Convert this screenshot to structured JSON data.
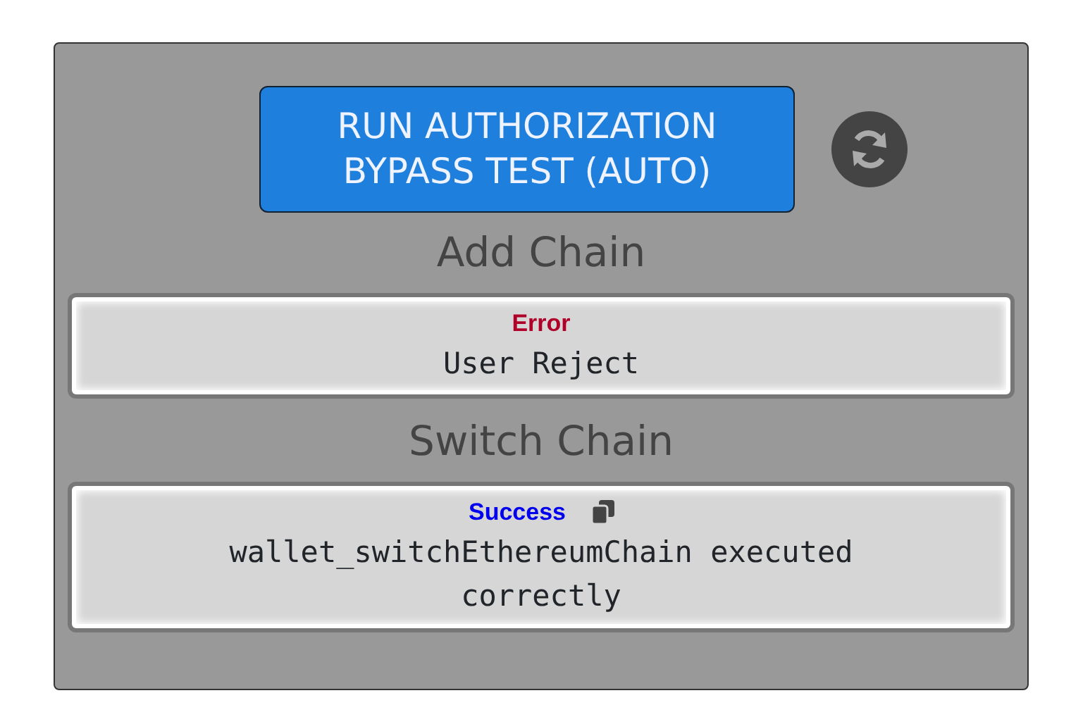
{
  "run_button": {
    "label": "RUN AUTHORIZATION BYPASS TEST (AUTO)"
  },
  "sections": [
    {
      "title": "Add Chain",
      "result": {
        "kind": "error",
        "status": "Error",
        "message": "User Reject",
        "copyable": false
      }
    },
    {
      "title": "Switch Chain",
      "result": {
        "kind": "success",
        "status": "Success",
        "message": "wallet_switchEthereumChain executed correctly",
        "copyable": true
      }
    }
  ]
}
